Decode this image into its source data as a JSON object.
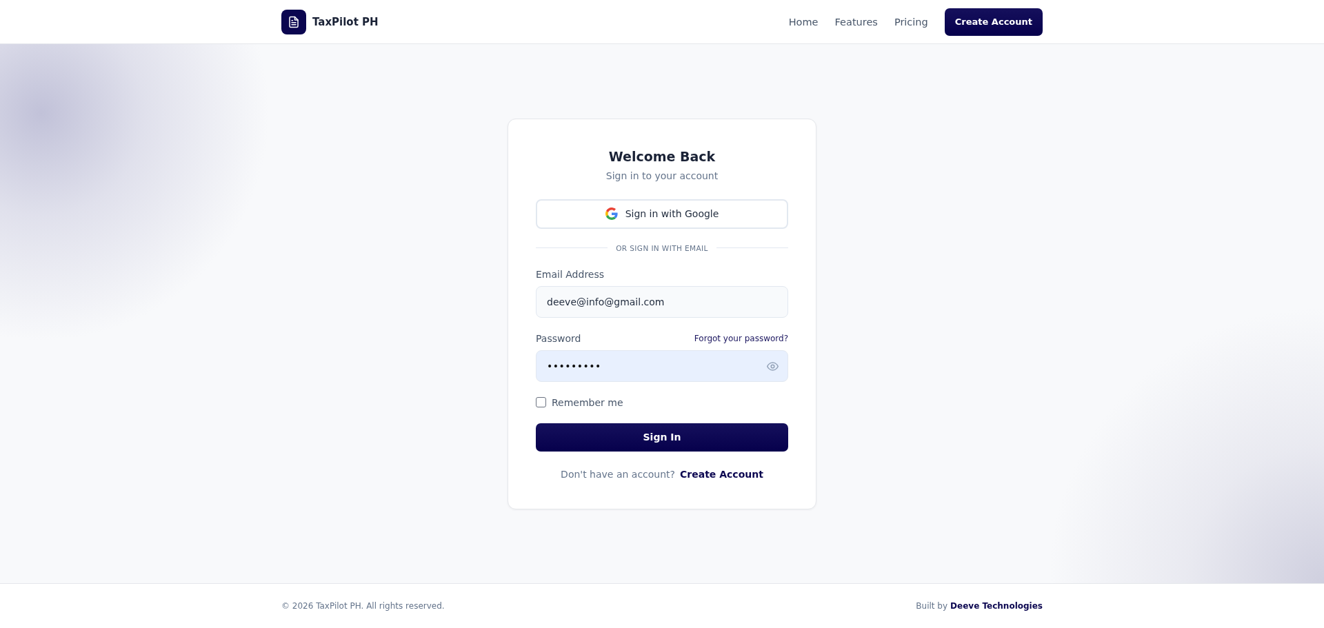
{
  "header": {
    "brand": "TaxPilot PH",
    "nav": [
      "Home",
      "Features",
      "Pricing"
    ],
    "cta_button": "Create Account"
  },
  "login_card": {
    "title": "Welcome Back",
    "subtitle": "Sign in to your account",
    "google_button": "Sign in with Google",
    "divider": "OR SIGN IN WITH EMAIL",
    "email": {
      "label": "Email Address",
      "value": "deeve@info@gmail.com",
      "autofilled": false
    },
    "password": {
      "label": "Password",
      "forgot_link": "Forgot your password?",
      "value": "•••••••••",
      "autofilled": true
    },
    "remember_me": {
      "label": "Remember me",
      "checked": false
    },
    "submit_button": "Sign In",
    "signup_prompt": "Don't have an account?",
    "signup_link": "Create Account"
  },
  "footer": {
    "copyright": "© 2026 TaxPilot PH. All rights reserved.",
    "built_by": "Built by",
    "company": "Deeve Technologies"
  }
}
